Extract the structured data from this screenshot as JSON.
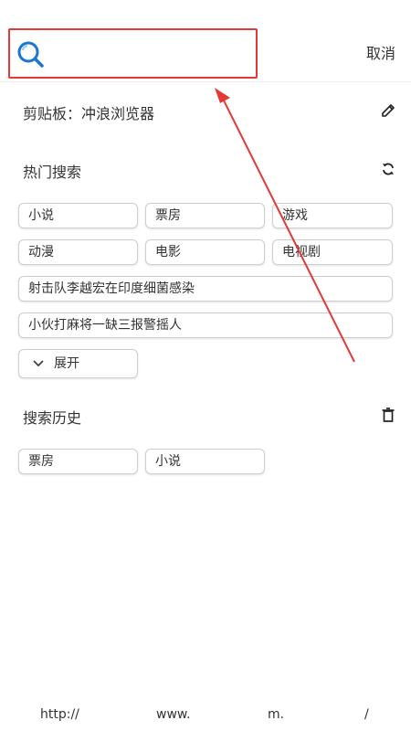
{
  "search": {
    "placeholder": "",
    "value": "",
    "cancel_label": "取消"
  },
  "clipboard": {
    "label": "剪贴板：冲浪浏览器"
  },
  "hot_search": {
    "title": "热门搜索",
    "tags_grid": [
      "小说",
      "票房",
      "游戏",
      "动漫",
      "电影",
      "电视剧"
    ],
    "tags_wide": [
      "射击队李越宏在印度细菌感染",
      "小伙打麻将一缺三报警摇人"
    ],
    "expand_label": "展开"
  },
  "history": {
    "title": "搜索历史",
    "items": [
      "票房",
      "小说"
    ]
  },
  "bottom_bar": [
    "http://",
    "www.",
    "m.",
    "/"
  ],
  "colors": {
    "accent": "#1976d2",
    "highlight": "#e53935",
    "border": "#cfcfcf"
  },
  "icons": {
    "search": "search-icon",
    "edit": "pencil-icon",
    "refresh": "refresh-icon",
    "delete": "trash-icon",
    "expand": "chevron-down-icon"
  }
}
